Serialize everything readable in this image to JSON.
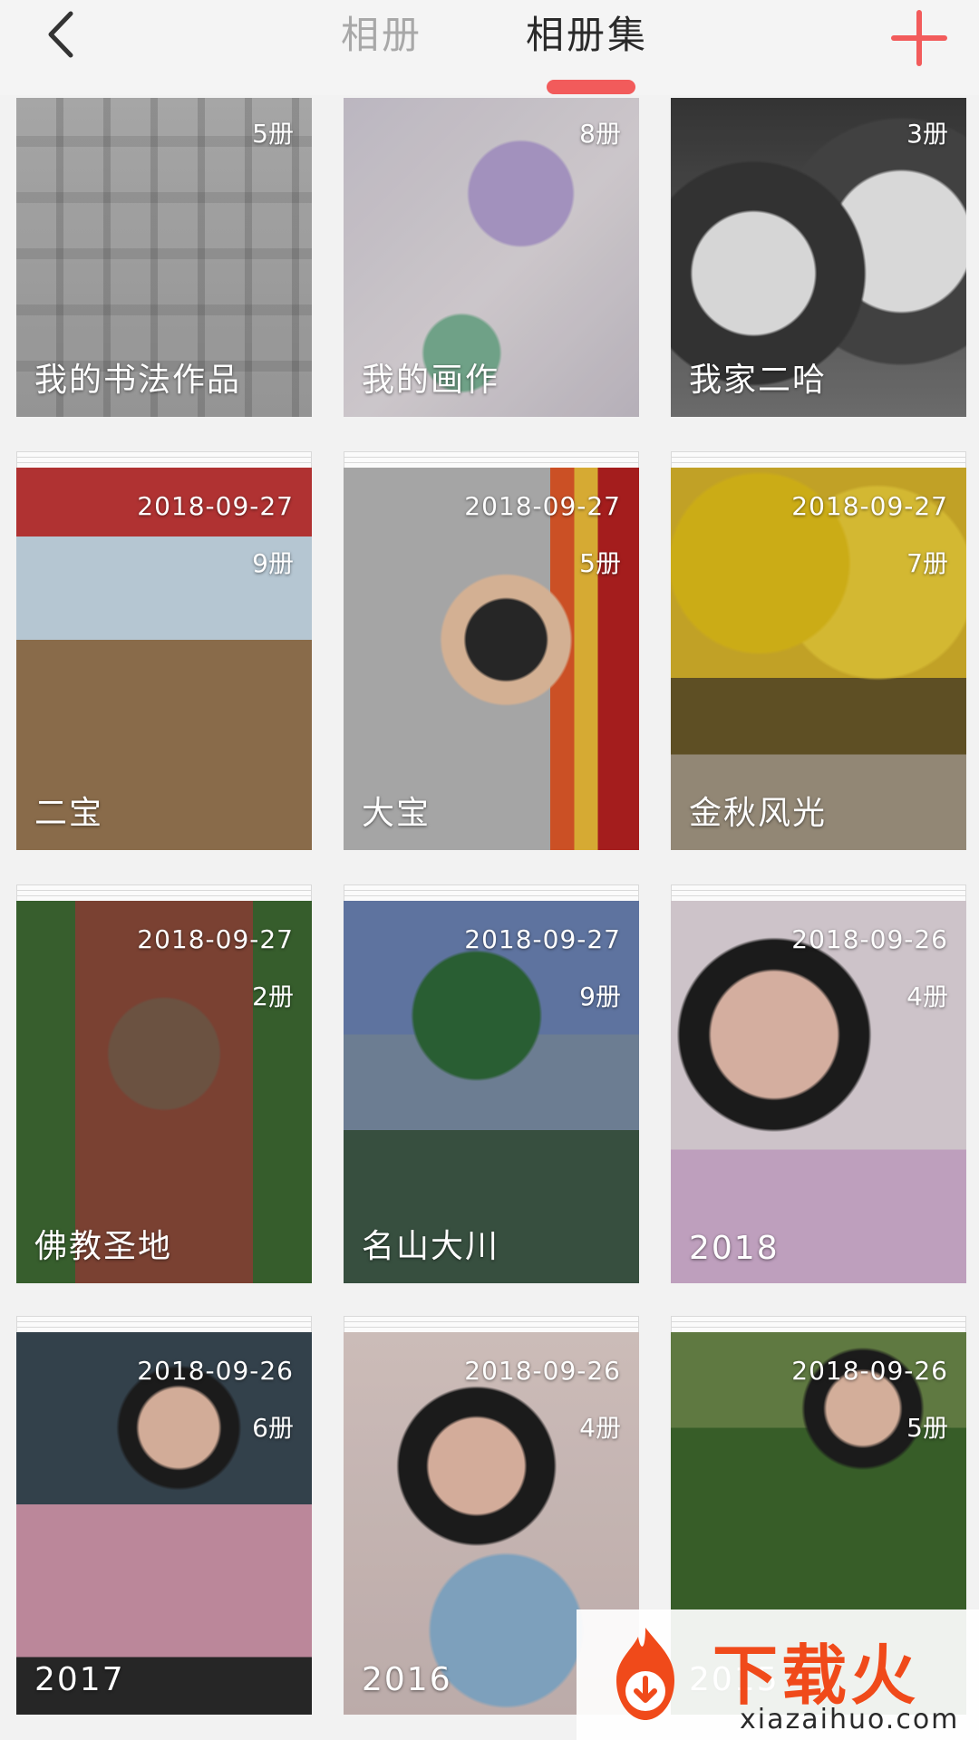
{
  "header": {
    "back_icon": "chevron-left-icon",
    "tabs": [
      {
        "label": "相册",
        "active": false
      },
      {
        "label": "相册集",
        "active": true
      }
    ],
    "add_icon": "plus-icon",
    "accent_color": "#f25b5b"
  },
  "albums": [
    {
      "title": "我的书法作品",
      "count": "5册",
      "date": ""
    },
    {
      "title": "我的画作",
      "count": "8册",
      "date": ""
    },
    {
      "title": "我家二哈",
      "count": "3册",
      "date": ""
    },
    {
      "title": "二宝",
      "count": "9册",
      "date": "2018-09-27"
    },
    {
      "title": "大宝",
      "count": "5册",
      "date": "2018-09-27"
    },
    {
      "title": "金秋风光",
      "count": "7册",
      "date": "2018-09-27"
    },
    {
      "title": "佛教圣地",
      "count": "2册",
      "date": "2018-09-27"
    },
    {
      "title": "名山大川",
      "count": "9册",
      "date": "2018-09-27"
    },
    {
      "title": "2018",
      "count": "4册",
      "date": "2018-09-26"
    },
    {
      "title": "2017",
      "count": "6册",
      "date": "2018-09-26"
    },
    {
      "title": "2016",
      "count": "4册",
      "date": "2018-09-26"
    },
    {
      "title": "2015",
      "count": "5册",
      "date": "2018-09-26"
    }
  ],
  "watermark": {
    "brand": "下载火",
    "url": "xiazaihuo.com",
    "brand_color": "#f04a1a"
  }
}
